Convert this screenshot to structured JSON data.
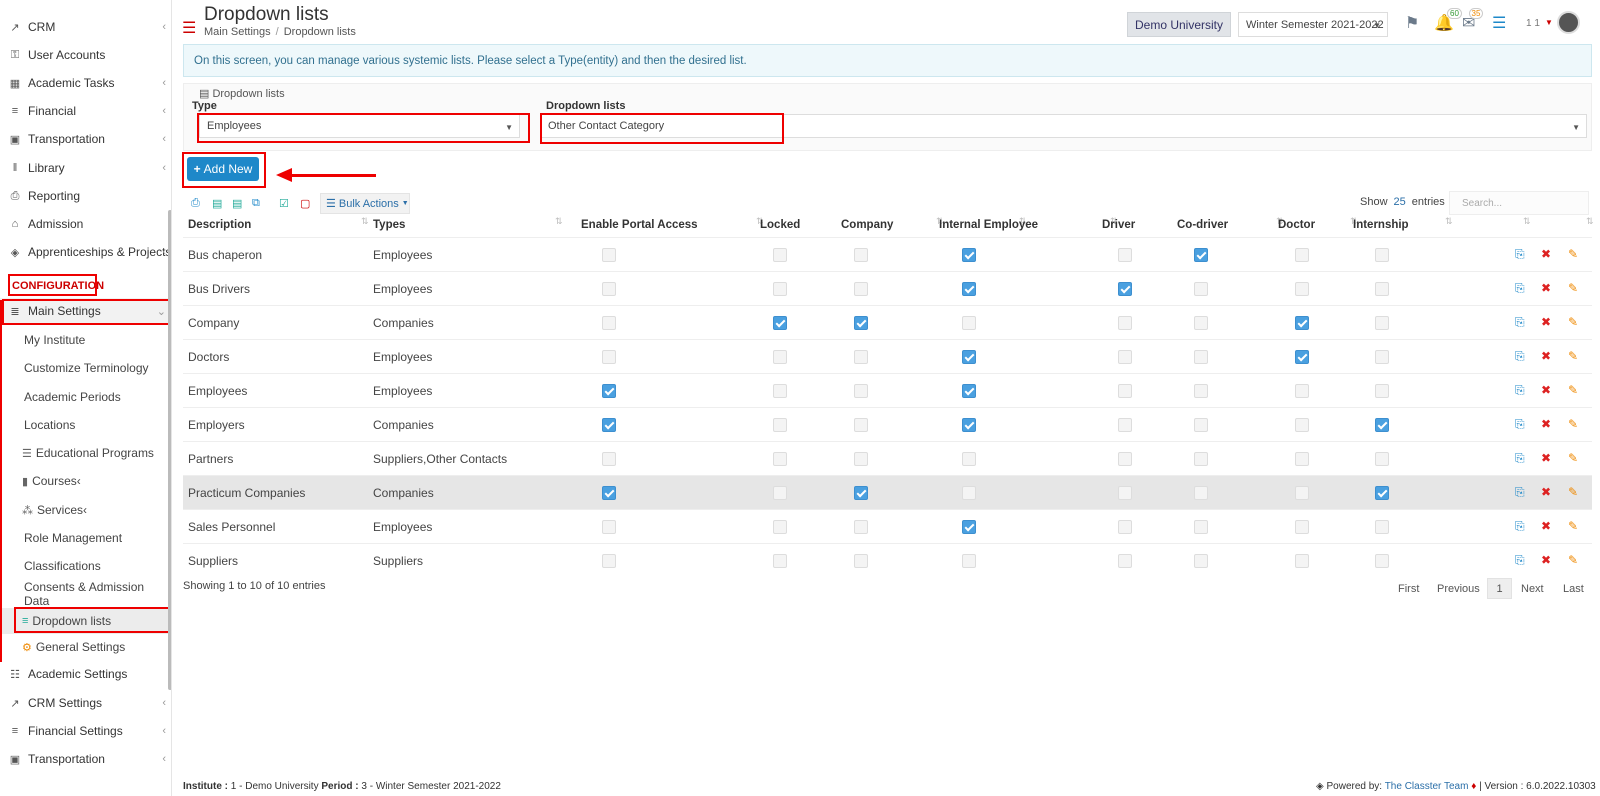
{
  "sidebar": {
    "items_top": [
      {
        "label": "CRM",
        "icon": "crm-icon"
      },
      {
        "label": "User Accounts",
        "icon": "key-icon"
      },
      {
        "label": "Academic Tasks",
        "icon": "grid-icon"
      },
      {
        "label": "Financial",
        "icon": "money-icon"
      },
      {
        "label": "Transportation",
        "icon": "bus-icon"
      },
      {
        "label": "Library",
        "icon": "books-icon"
      },
      {
        "label": "Reporting",
        "icon": "printer-icon"
      },
      {
        "label": "Admission",
        "icon": "building-icon"
      },
      {
        "label": "Apprenticeships & Projects",
        "icon": "box-icon"
      }
    ],
    "section_heading": "CONFIGURATION",
    "main_settings": "Main Settings",
    "sub_items": [
      "My Institute",
      "Customize Terminology",
      "Academic Periods",
      "Locations",
      "Educational Programs",
      "Courses",
      "Services",
      "Role Management",
      "Classifications",
      "Consents & Admission Data",
      "Dropdown lists",
      "General Settings"
    ],
    "items_bottom": [
      {
        "label": "Academic Settings",
        "icon": "academic-settings-icon"
      },
      {
        "label": "CRM Settings",
        "icon": "crm-icon"
      },
      {
        "label": "Financial Settings",
        "icon": "money-icon"
      },
      {
        "label": "Transportation",
        "icon": "bus-icon"
      }
    ]
  },
  "header": {
    "title": "Dropdown lists",
    "breadcrumb": [
      "Main Settings",
      "Dropdown lists"
    ],
    "university": "Demo University",
    "semester": "Winter Semester 2021-2022",
    "notif_count": "60",
    "mail_count": "35",
    "user_num": "1 1"
  },
  "info_text": "On this screen, you can manage various systemic lists. Please select a Type(entity) and then the desired list.",
  "filter": {
    "legend": "Dropdown lists",
    "type_label": "Type",
    "type_value": "Employees",
    "list_label": "Dropdown lists",
    "list_value": "Other Contact Category"
  },
  "add_new_label": "Add New",
  "toolbar": {
    "bulk_actions": "Bulk Actions",
    "show_label": "Show",
    "show_value": "25",
    "entries_label": "entries",
    "search_placeholder": "Search..."
  },
  "table": {
    "columns": [
      "Description",
      "Types",
      "Enable Portal Access",
      "Locked",
      "Company",
      "Internal Employee",
      "Driver",
      "Co-driver",
      "Doctor",
      "Internship"
    ],
    "rows": [
      {
        "description": "Bus chaperon",
        "types": "Employees",
        "flags": [
          false,
          false,
          false,
          true,
          false,
          true,
          false,
          false
        ]
      },
      {
        "description": "Bus Drivers",
        "types": "Employees",
        "flags": [
          false,
          false,
          false,
          true,
          true,
          false,
          false,
          false
        ]
      },
      {
        "description": "Company",
        "types": "Companies",
        "flags": [
          false,
          true,
          true,
          false,
          false,
          false,
          true,
          false
        ]
      },
      {
        "description": "Doctors",
        "types": "Employees",
        "flags": [
          false,
          false,
          false,
          true,
          false,
          false,
          true,
          false
        ]
      },
      {
        "description": "Employees",
        "types": "Employees",
        "flags": [
          true,
          false,
          false,
          true,
          false,
          false,
          false,
          false
        ]
      },
      {
        "description": "Employers",
        "types": "Companies",
        "flags": [
          true,
          false,
          false,
          true,
          false,
          false,
          false,
          true
        ]
      },
      {
        "description": "Partners",
        "types": "Suppliers,Other Contacts",
        "flags": [
          false,
          false,
          false,
          false,
          false,
          false,
          false,
          false
        ]
      },
      {
        "description": "Practicum Companies",
        "types": "Companies",
        "flags": [
          true,
          false,
          true,
          false,
          false,
          false,
          false,
          true
        ]
      },
      {
        "description": "Sales Personnel",
        "types": "Employees",
        "flags": [
          false,
          false,
          false,
          true,
          false,
          false,
          false,
          false
        ]
      },
      {
        "description": "Suppliers",
        "types": "Suppliers",
        "flags": [
          false,
          false,
          false,
          false,
          false,
          false,
          false,
          false
        ]
      }
    ],
    "highlighted_row": 7
  },
  "footer": {
    "showing": "Showing 1 to 10 of 10 entries",
    "pager": [
      "First",
      "Previous",
      "1",
      "Next",
      "Last"
    ],
    "institute_label": "Institute :",
    "institute_value": "1 - Demo University",
    "period_label": "Period :",
    "period_value": "3 - Winter Semester 2021-2022",
    "powered_by": "Powered by:",
    "powered_link": "The Classter Team",
    "version": "| Version : 6.0.2022.10303"
  },
  "colors": {
    "accent": "#1e88c9",
    "annotation_red": "#e00000",
    "checkbox_on": "#4aa0e0"
  }
}
